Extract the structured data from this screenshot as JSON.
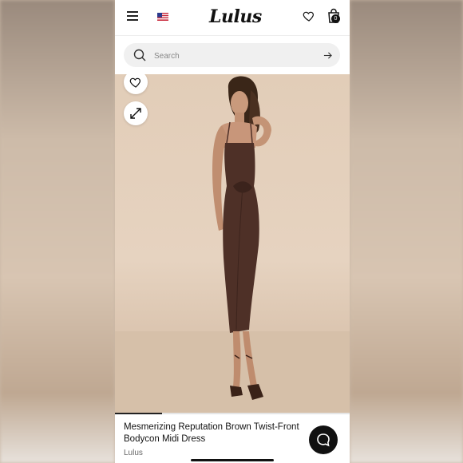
{
  "header": {
    "logo": "Lulus",
    "bag_count": "0",
    "country_flag": "us-flag-icon"
  },
  "search": {
    "placeholder": "Search"
  },
  "gallery": {
    "progress": 0.2,
    "image_description_icon": "product-photo"
  },
  "product": {
    "title": "Mesmerizing Reputation Brown Twist-Front Bodycon Midi Dress",
    "brand": "Lulus"
  },
  "colors": {
    "accent": "#111111",
    "dress": "#4e3027",
    "backdrop": "#e2cdb8"
  },
  "icons": [
    "menu-icon",
    "us-flag-icon",
    "heart-icon",
    "shopping-bag-icon",
    "search-icon",
    "arrow-right-icon",
    "expand-icon",
    "chat-icon"
  ]
}
